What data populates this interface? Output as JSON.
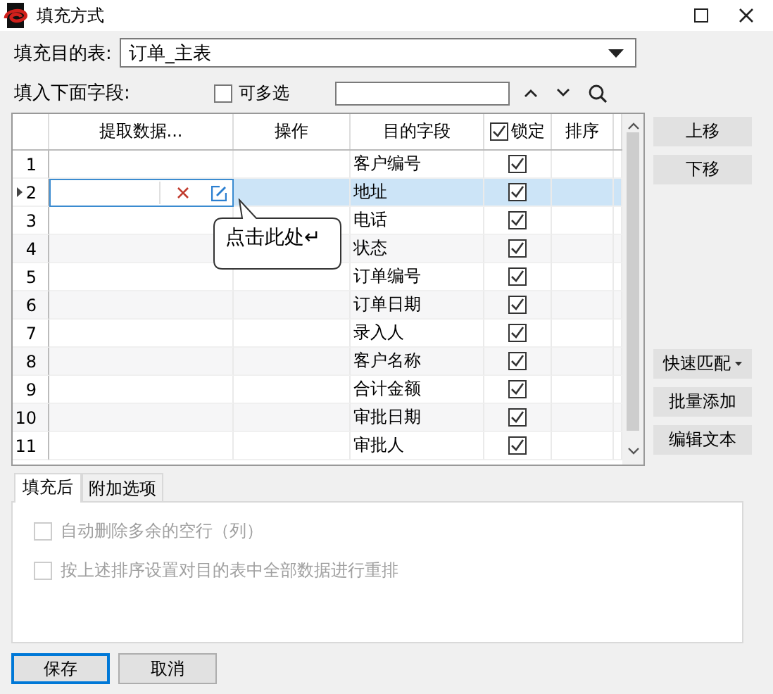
{
  "window": {
    "title": "填充方式"
  },
  "target_table": {
    "label": "填充目的表:",
    "value": "订单_主表"
  },
  "fields_label": "填入下面字段:",
  "multi_select": {
    "label": "可多选",
    "checked": false
  },
  "grid": {
    "columns": [
      "提取数据...",
      "操作",
      "目的字段",
      "锁定",
      "排序"
    ],
    "lock_all_checked": true,
    "rows": [
      {
        "number": "1",
        "target_field": "客户编号",
        "locked": true,
        "selected": false
      },
      {
        "number": "2",
        "target_field": "地址",
        "locked": true,
        "selected": true
      },
      {
        "number": "3",
        "target_field": "电话",
        "locked": true,
        "selected": false
      },
      {
        "number": "4",
        "target_field": "状态",
        "locked": true,
        "selected": false
      },
      {
        "number": "5",
        "target_field": "订单编号",
        "locked": true,
        "selected": false
      },
      {
        "number": "6",
        "target_field": "订单日期",
        "locked": true,
        "selected": false
      },
      {
        "number": "7",
        "target_field": "录入人",
        "locked": true,
        "selected": false
      },
      {
        "number": "8",
        "target_field": "客户名称",
        "locked": true,
        "selected": false
      },
      {
        "number": "9",
        "target_field": "合计金额",
        "locked": true,
        "selected": false
      },
      {
        "number": "10",
        "target_field": "审批日期",
        "locked": true,
        "selected": false
      },
      {
        "number": "11",
        "target_field": "审批人",
        "locked": true,
        "selected": false
      }
    ]
  },
  "callout": "点击此处↵",
  "move_buttons": [
    "上移",
    "下移"
  ],
  "tool_buttons": [
    {
      "label": "快速匹配",
      "kind": "dropdown"
    },
    {
      "label": "批量添加",
      "kind": "plain"
    },
    {
      "label": "编辑文本",
      "kind": "plain"
    }
  ],
  "tabs": [
    {
      "label": "填充后",
      "selected": true
    },
    {
      "label": "附加选项",
      "selected": false
    }
  ],
  "options": [
    {
      "label": "自动删除多余的空行（列）",
      "checked": false,
      "disabled": true
    },
    {
      "label": "按上述排序设置对目的表中全部数据进行重排",
      "checked": false,
      "disabled": true
    }
  ],
  "buttons": [
    {
      "label": "保存",
      "default": true
    },
    {
      "label": "取消",
      "default": false
    }
  ]
}
